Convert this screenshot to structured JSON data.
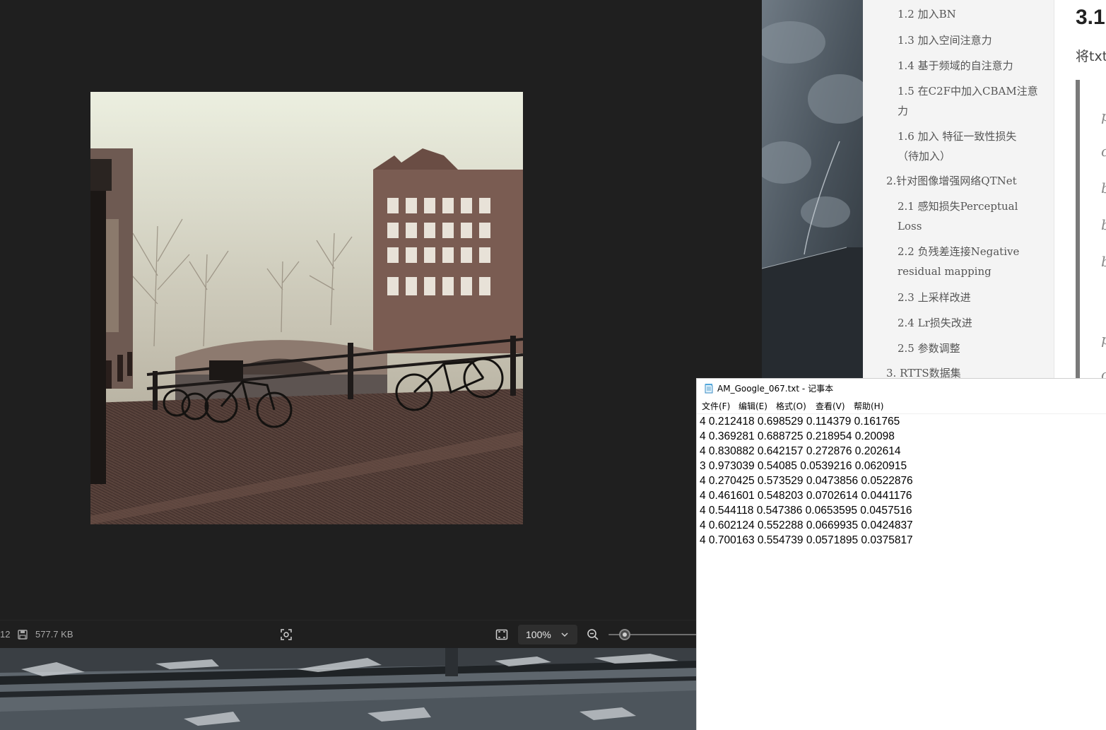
{
  "viewer": {
    "status_left": "12",
    "file_size": "577.7 KB",
    "zoom_level": "100%",
    "zoom_fraction": 0.18,
    "icons": [
      "disk-icon",
      "focus-icon",
      "fit-screen-icon",
      "chevron-down-icon",
      "zoom-out-icon"
    ]
  },
  "blog_outline": {
    "items": [
      {
        "label": "1.2 加入BN"
      },
      {
        "label": "1.3 加入空间注意力"
      },
      {
        "label": "1.4 基于频域的自注意力"
      },
      {
        "label": "1.5 在C2F中加入CBAM注意",
        "label2": "力"
      },
      {
        "label": "1.6 加入 特征一致性损失",
        "label2": "（待加入）"
      },
      {
        "label": "2.针对图像增强网络QTNet"
      },
      {
        "label": "2.1 感知损失Perceptual",
        "label2": "Loss"
      },
      {
        "label": "2.2 负残差连接Negative",
        "label2": "residual mapping"
      },
      {
        "label": "2.3 上采样改进"
      },
      {
        "label": "2.4 Lr损失改进"
      },
      {
        "label": "2.5 参数调整"
      },
      {
        "label": "3. RTTS数据集"
      }
    ]
  },
  "blog_content": {
    "heading": "3.1",
    "line": "将txt",
    "code_chars": [
      "p",
      "c",
      "b",
      "b",
      "b",
      "p",
      "c"
    ]
  },
  "notepad": {
    "title": "AM_Google_067.txt - 记事本",
    "menu": [
      "文件(F)",
      "编辑(E)",
      "格式(O)",
      "查看(V)",
      "帮助(H)"
    ],
    "lines": [
      "4 0.212418 0.698529 0.114379 0.161765",
      "4 0.369281 0.688725 0.218954 0.20098",
      "4 0.830882 0.642157 0.272876 0.202614",
      "3 0.973039 0.54085 0.0539216 0.0620915",
      "4 0.270425 0.573529 0.0473856 0.0522876",
      "4 0.461601 0.548203 0.0702614 0.0441176",
      "4 0.544118 0.547386 0.0653595 0.0457516",
      "4 0.602124 0.552288 0.0669935 0.0424837",
      "4 0.700163 0.554739 0.0571895 0.0375817"
    ]
  },
  "colors": {
    "viewer_bg": "#1f1f1f",
    "outline_bg": "#f4f4f4",
    "outline_text": "#555555",
    "notepad_bg": "#ffffff"
  }
}
